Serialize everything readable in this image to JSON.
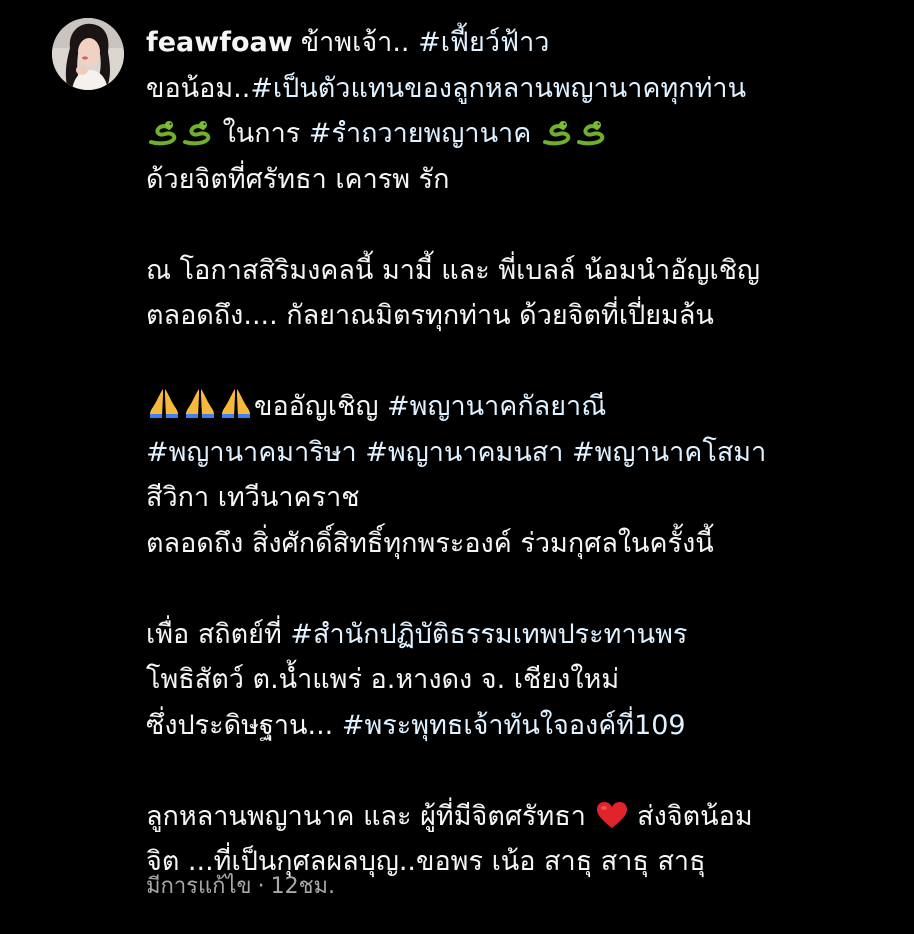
{
  "post": {
    "username": "feawfoaw",
    "lines": [
      {
        "p1": "ข้าพเจ้า..",
        "h1": "#เฟี้ยว์ฟ้าว"
      },
      {
        "p1": "ขอน้อม..",
        "h1": "#เป็นตัวแทนของลูกหลานพญานาคทุกท่าน"
      },
      {
        "p1": "ในการ",
        "h1": "#รำถวายพญานาค"
      },
      {
        "p1": "ด้วยจิตที่ศรัทธา เคารพ รัก"
      },
      {
        "p1": "ณ โอกาสสิริมงคลนี้ มามี้ และ พี่เบลล์ น้อมนำอัญเชิญ"
      },
      {
        "p1": "ตลอดถึง.... กัลยาณมิตรทุกท่าน ด้วยจิตที่เปี่ยมล้น"
      },
      {
        "p1": "ขออัญเชิญ",
        "h1": "#พญานาคกัลยาณี"
      },
      {
        "h1": "#พญานาคมาริษา",
        "h2": "#พญานาคมนสา",
        "h3": "#พญานาคโสมา"
      },
      {
        "p1": "สีวิกา  เทวีนาคราช"
      },
      {
        "p1": "ตลอดถึง สิ่งศักดิ์สิทธิ์ทุกพระองค์ ร่วมกุศลในครั้งนี้"
      },
      {
        "p1": "เพื่อ สถิตย์ที่",
        "h1": "#สำนักปฏิบัติธรรมเทพประทานพร"
      },
      {
        "p1": "โพธิสัตว์ ต.น้ำแพร่ อ.หางดง จ. เชียงใหม่"
      },
      {
        "p1": "ซึ่งประดิษฐาน...",
        "h1": "#พระพุทธเจ้าทันใจองค์ที่109"
      },
      {
        "p1": "ลูกหลานพญานาค และ ผู้ที่มีจิตศรัทธา",
        "p2": "ส่งจิตน้อม"
      },
      {
        "p1": "จิต ...ที่เป็นกุศลผลบุญ..ขอพร เน้อ สาธุ สาธุ สาธุ"
      }
    ],
    "edited_label": "มีการแก้ไข",
    "separator": "·",
    "time_ago": "12ชม."
  },
  "icons": {
    "snake": "snake-emoji",
    "pray": "folded-hands-emoji",
    "heart": "red-heart-emoji"
  },
  "colors": {
    "background": "#000000",
    "text": "#f5f5f5",
    "hashtag": "#e0f1ff",
    "meta": "#a8a8a8"
  }
}
